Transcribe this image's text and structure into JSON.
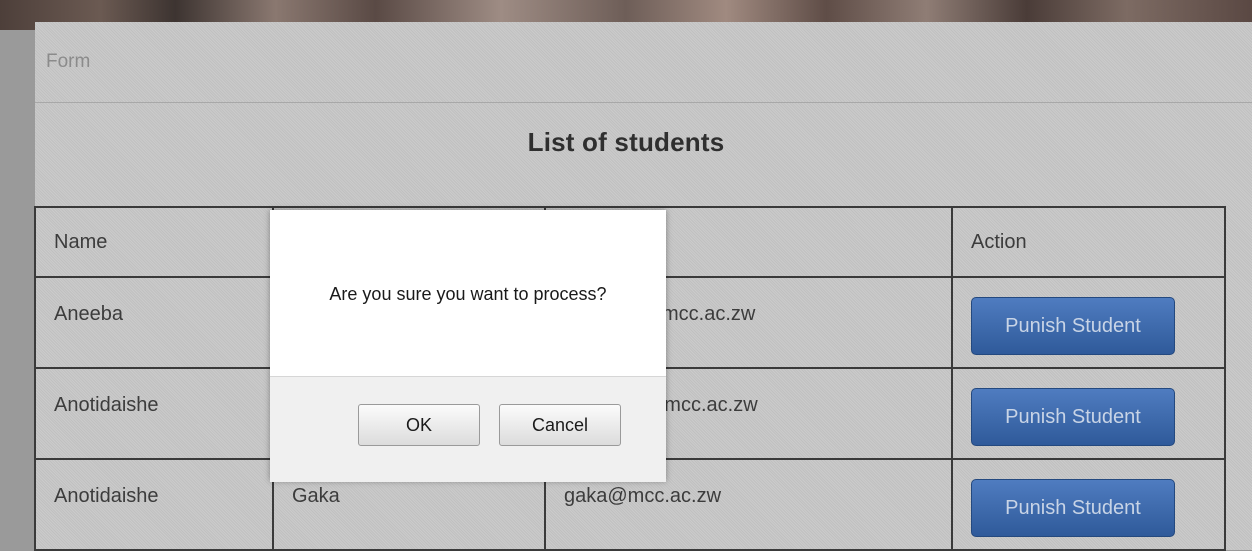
{
  "panel": {
    "title": "Form"
  },
  "list_title": "List of students",
  "table": {
    "headers": [
      "Name",
      "",
      "",
      "Action"
    ],
    "rows": [
      {
        "name": "Aneeba",
        "surname": "",
        "email": "mcc.ac.zw",
        "action": "Punish Student"
      },
      {
        "name": "Anotidaishe",
        "surname": "",
        "email": "@mcc.ac.zw",
        "action": "Punish Student"
      },
      {
        "name": "Anotidaishe",
        "surname": "Gaka",
        "email": "gaka@mcc.ac.zw",
        "action": "Punish Student"
      }
    ]
  },
  "dialog": {
    "message": "Are you sure you want to process?",
    "ok_label": "OK",
    "cancel_label": "Cancel"
  },
  "colors": {
    "button_blue": "#3a67aa",
    "panel_gray": "#c8c8c8"
  }
}
